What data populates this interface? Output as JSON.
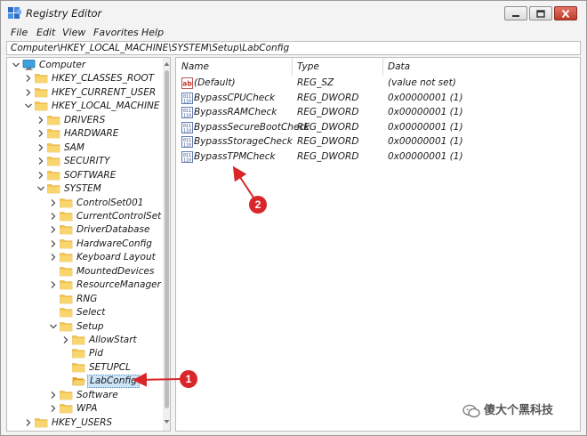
{
  "window": {
    "title": "Registry Editor"
  },
  "menu": [
    "File",
    "Edit",
    "View",
    "Favorites",
    "Help"
  ],
  "address": "Computer\\HKEY_LOCAL_MACHINE\\SYSTEM\\Setup\\LabConfig",
  "tree": [
    {
      "label": "Computer",
      "depth": 0,
      "expander": "expanded",
      "icon": "computer-icon"
    },
    {
      "label": "HKEY_CLASSES_ROOT",
      "depth": 1,
      "expander": "collapsed",
      "icon": "folder-icon"
    },
    {
      "label": "HKEY_CURRENT_USER",
      "depth": 1,
      "expander": "collapsed",
      "icon": "folder-icon"
    },
    {
      "label": "HKEY_LOCAL_MACHINE",
      "depth": 1,
      "expander": "expanded",
      "icon": "folder-icon"
    },
    {
      "label": "DRIVERS",
      "depth": 2,
      "expander": "collapsed",
      "icon": "folder-icon"
    },
    {
      "label": "HARDWARE",
      "depth": 2,
      "expander": "collapsed",
      "icon": "folder-icon"
    },
    {
      "label": "SAM",
      "depth": 2,
      "expander": "collapsed",
      "icon": "folder-icon"
    },
    {
      "label": "SECURITY",
      "depth": 2,
      "expander": "collapsed",
      "icon": "folder-icon"
    },
    {
      "label": "SOFTWARE",
      "depth": 2,
      "expander": "collapsed",
      "icon": "folder-icon"
    },
    {
      "label": "SYSTEM",
      "depth": 2,
      "expander": "expanded",
      "icon": "folder-icon"
    },
    {
      "label": "ControlSet001",
      "depth": 3,
      "expander": "collapsed",
      "icon": "folder-icon"
    },
    {
      "label": "CurrentControlSet",
      "depth": 3,
      "expander": "collapsed",
      "icon": "folder-icon"
    },
    {
      "label": "DriverDatabase",
      "depth": 3,
      "expander": "collapsed",
      "icon": "folder-icon"
    },
    {
      "label": "HardwareConfig",
      "depth": 3,
      "expander": "collapsed",
      "icon": "folder-icon"
    },
    {
      "label": "Keyboard Layout",
      "depth": 3,
      "expander": "collapsed",
      "icon": "folder-icon"
    },
    {
      "label": "MountedDevices",
      "depth": 3,
      "expander": "none",
      "icon": "folder-icon"
    },
    {
      "label": "ResourceManager",
      "depth": 3,
      "expander": "collapsed",
      "icon": "folder-icon"
    },
    {
      "label": "RNG",
      "depth": 3,
      "expander": "none",
      "icon": "folder-icon"
    },
    {
      "label": "Select",
      "depth": 3,
      "expander": "none",
      "icon": "folder-icon"
    },
    {
      "label": "Setup",
      "depth": 3,
      "expander": "expanded",
      "icon": "folder-icon"
    },
    {
      "label": "AllowStart",
      "depth": 4,
      "expander": "collapsed",
      "icon": "folder-icon"
    },
    {
      "label": "Pid",
      "depth": 4,
      "expander": "none",
      "icon": "folder-icon"
    },
    {
      "label": "SETUPCL",
      "depth": 4,
      "expander": "none",
      "icon": "folder-icon"
    },
    {
      "label": "LabConfig",
      "depth": 4,
      "expander": "none",
      "icon": "folder-open-icon",
      "selected": true
    },
    {
      "label": "Software",
      "depth": 3,
      "expander": "collapsed",
      "icon": "folder-icon"
    },
    {
      "label": "WPA",
      "depth": 3,
      "expander": "collapsed",
      "icon": "folder-icon"
    },
    {
      "label": "HKEY_USERS",
      "depth": 1,
      "expander": "collapsed",
      "icon": "folder-icon"
    }
  ],
  "list": {
    "columns": [
      "Name",
      "Type",
      "Data"
    ],
    "rows": [
      {
        "name": "(Default)",
        "type": "REG_SZ",
        "data": "(value not set)",
        "icon": "string-value-icon"
      },
      {
        "name": "BypassCPUCheck",
        "type": "REG_DWORD",
        "data": "0x00000001 (1)",
        "icon": "binary-value-icon"
      },
      {
        "name": "BypassRAMCheck",
        "type": "REG_DWORD",
        "data": "0x00000001 (1)",
        "icon": "binary-value-icon"
      },
      {
        "name": "BypassSecureBootCheck",
        "type": "REG_DWORD",
        "data": "0x00000001 (1)",
        "icon": "binary-value-icon"
      },
      {
        "name": "BypassStorageCheck",
        "type": "REG_DWORD",
        "data": "0x00000001 (1)",
        "icon": "binary-value-icon"
      },
      {
        "name": "BypassTPMCheck",
        "type": "REG_DWORD",
        "data": "0x00000001 (1)",
        "icon": "binary-value-icon"
      }
    ]
  },
  "annotations": [
    {
      "number": "1",
      "target": "LabConfig"
    },
    {
      "number": "2",
      "target": "BypassTPMCheck"
    }
  ],
  "watermark": {
    "text": "傻大个黑科技",
    "icon": "wechat-icon"
  },
  "colors": {
    "accent_selection": "#cce4f7",
    "annotation_red": "#d9262a",
    "folder_yellow": "#f5c44d"
  }
}
